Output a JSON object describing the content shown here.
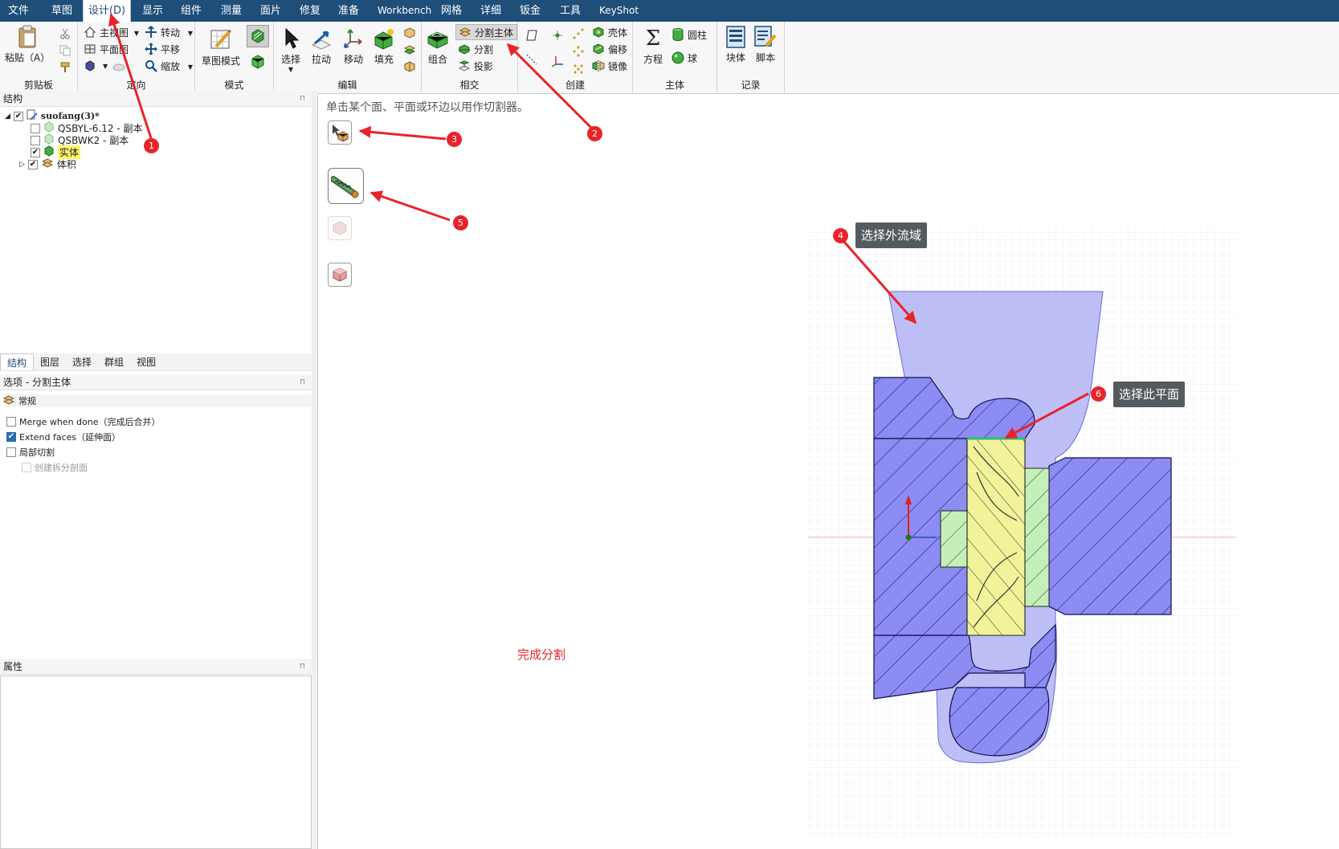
{
  "menu": {
    "items": [
      "文件",
      "草图",
      "设计(D)",
      "显示",
      "组件",
      "测量",
      "面片",
      "修复",
      "准备",
      "Workbench",
      "网格",
      "详细",
      "钣金",
      "工具",
      "KeyShot"
    ],
    "active_index": 2
  },
  "ribbon": {
    "clipboard": {
      "title": "剪贴板",
      "paste": "粘贴（A）"
    },
    "orient": {
      "title": "定向",
      "home_view": "主视图",
      "plane_view": "平面图",
      "spin": "转动",
      "pan": "平移",
      "zoom": "缩放"
    },
    "mode": {
      "title": "模式",
      "sketch_mode": "草图模式"
    },
    "edit": {
      "title": "编辑",
      "select": "选择",
      "pull": "拉动",
      "move": "移动",
      "fill": "填充"
    },
    "intersect": {
      "title": "相交",
      "combine": "组合",
      "split_body": "分割主体",
      "split": "分割",
      "project": "投影"
    },
    "create": {
      "title": "创建",
      "shell": "壳体",
      "offset": "偏移",
      "mirror": "镜像"
    },
    "body": {
      "title": "主体",
      "equation": "方程",
      "cylinder": "圆柱",
      "sphere": "球"
    },
    "record": {
      "title": "记录",
      "block": "块体",
      "script": "脚本"
    }
  },
  "structure_panel": {
    "title": "结构",
    "root": "suofang(3)*",
    "items": [
      {
        "label": "QSBYL-6.12 - 副本",
        "checked": false
      },
      {
        "label": "QSBWK2 - 副本",
        "checked": false
      },
      {
        "label": "实体",
        "checked": true
      },
      {
        "label": "体积",
        "checked": true
      }
    ]
  },
  "bottom_tabs": [
    "结构",
    "图层",
    "选择",
    "群组",
    "视图"
  ],
  "options_panel": {
    "title": "选项 - 分割主体",
    "section": "常规",
    "options": [
      {
        "label": "Merge when done（完成后合并）",
        "checked": false
      },
      {
        "label": "Extend faces（延伸面）",
        "checked": true
      },
      {
        "label": "局部切割",
        "checked": false
      },
      {
        "label": "创建拆分剖面",
        "checked": false,
        "disabled": true
      }
    ]
  },
  "properties_panel": {
    "title": "属性"
  },
  "viewport": {
    "hint": "单击某个面、平面或环边以用作切割器。",
    "done_text": "完成分割",
    "callout_outer": "选择外流域",
    "callout_plane": "选择此平面"
  },
  "annotations": [
    "1",
    "2",
    "3",
    "4",
    "5",
    "6"
  ],
  "colors": {
    "menubar": "#1f4e79",
    "annotation_red": "#e8242a",
    "fluid_blue": "#8c8cf2",
    "selected_yellow": "#f1f39a",
    "selected_green": "#c5efb8",
    "callout_gray": "#555a5e"
  }
}
